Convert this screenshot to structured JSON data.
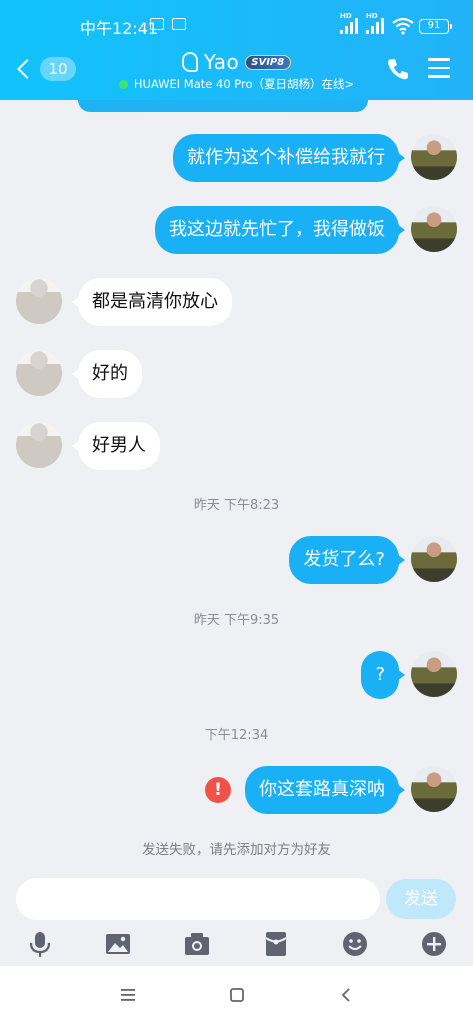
{
  "status_bar": {
    "time": "中午12:41",
    "battery": "91",
    "hd1": "HD",
    "hd2": "HD"
  },
  "header": {
    "back_count": "10",
    "contact_name": "Yao",
    "vip_badge": "SVIP8",
    "device_status": "HUAWEI Mate 40 Pro（夏日胡杨）在线>"
  },
  "messages": {
    "m1": "就作为这个补偿给我就行",
    "m2": "我这边就先忙了，我得做饭",
    "m3": "都是高清你放心",
    "m4": "好的",
    "m5": "好男人",
    "ts1": "昨天 下午8:23",
    "m6": "发货了么?",
    "ts2": "昨天 下午9:35",
    "m7": "?",
    "ts3": "下午12:34",
    "m8": "你这套路真深呐",
    "fail_icon": "!",
    "fail_notice": "发送失败，请先添加对方为好友"
  },
  "input": {
    "value": "",
    "placeholder": "",
    "send_label": "发送"
  },
  "colors": {
    "header_gradient_start": "#12c3fb",
    "header_gradient_end": "#22b2f8",
    "out_bubble": "#1ab0f5",
    "in_bubble": "#ffffff",
    "chat_bg": "#eef0f4",
    "error": "#f0524a",
    "send_disabled": "#bfe8fb"
  },
  "toolbar_icons": [
    "microphone-icon",
    "image-icon",
    "camera-icon",
    "red-packet-icon",
    "emoji-icon",
    "plus-icon"
  ],
  "nav_icons": [
    "menu-nav-icon",
    "home-nav-icon",
    "back-nav-icon"
  ]
}
